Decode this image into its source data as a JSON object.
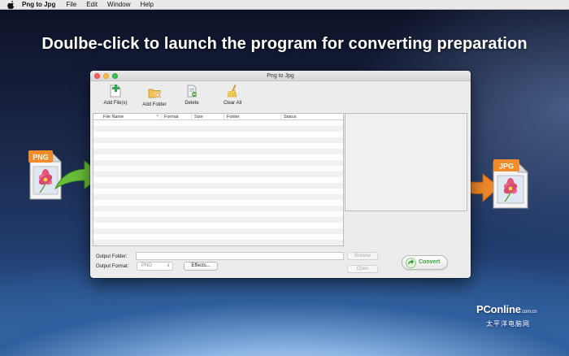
{
  "menubar": {
    "app_name": "Png to Jpg",
    "items": [
      "File",
      "Edit",
      "Window",
      "Help"
    ]
  },
  "headline": "Doulbe-click to launch the program for converting preparation",
  "window": {
    "title": "Png to Jpg",
    "toolbar": {
      "add_files": "Add File(s)",
      "add_folder": "Add Folder",
      "delete": "Delete",
      "clear_all": "Clear All"
    },
    "table": {
      "columns": [
        "File Name",
        "Format",
        "Size",
        "Folder",
        "Status"
      ]
    },
    "output_folder_label": "Output Folder:",
    "output_format_label": "Output Format:",
    "output_format_value": "PNG",
    "effects_button": "Effects...",
    "browse_button": "Browse",
    "open_button": "Open",
    "convert_button": "Convert"
  },
  "file_badges": {
    "left": "PNG",
    "right": "JPG"
  },
  "watermark": {
    "brand": "PConline",
    "sub": "太平洋电脑网",
    "domain": ".com.cn"
  },
  "colors": {
    "accent_green": "#3aa33c",
    "png_badge": "#f08c2a",
    "jpg_badge": "#f08c2a",
    "arrow_green": "#6abf3a",
    "arrow_orange": "#f0882a"
  }
}
